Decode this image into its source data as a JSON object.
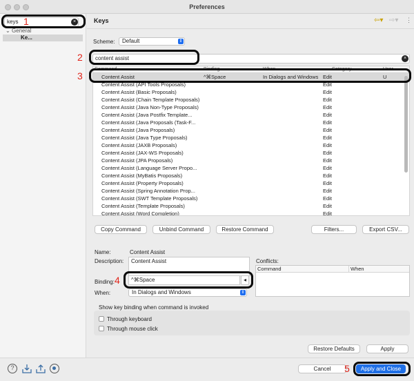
{
  "window": {
    "title": "Preferences"
  },
  "sidebar": {
    "filter_value": "keys",
    "tree": {
      "group": "General",
      "item": "Ke..."
    }
  },
  "header": {
    "title": "Keys"
  },
  "scheme": {
    "label": "Scheme:",
    "value": "Default"
  },
  "command_filter": {
    "value": "content assist"
  },
  "table": {
    "columns": [
      "Command",
      "Binding",
      "When",
      "Category",
      "User"
    ],
    "rows": [
      {
        "command": "Content Assist",
        "binding": "^⌘Space",
        "when": "In Dialogs and Windows",
        "category": "Edit",
        "user": "U"
      },
      {
        "command": "Content Assist (API Tools Proposals)",
        "binding": "",
        "when": "",
        "category": "Edit",
        "user": ""
      },
      {
        "command": "Content Assist (Basic Proposals)",
        "binding": "",
        "when": "",
        "category": "Edit",
        "user": ""
      },
      {
        "command": "Content Assist (Chain Template Proposals)",
        "binding": "",
        "when": "",
        "category": "Edit",
        "user": ""
      },
      {
        "command": "Content Assist (Java Non-Type Proposals)",
        "binding": "",
        "when": "",
        "category": "Edit",
        "user": ""
      },
      {
        "command": "Content Assist (Java Postfix Template...",
        "binding": "",
        "when": "",
        "category": "Edit",
        "user": ""
      },
      {
        "command": "Content Assist (Java Proposals (Task-F...",
        "binding": "",
        "when": "",
        "category": "Edit",
        "user": ""
      },
      {
        "command": "Content Assist (Java Proposals)",
        "binding": "",
        "when": "",
        "category": "Edit",
        "user": ""
      },
      {
        "command": "Content Assist (Java Type Proposals)",
        "binding": "",
        "when": "",
        "category": "Edit",
        "user": ""
      },
      {
        "command": "Content Assist (JAXB Proposals)",
        "binding": "",
        "when": "",
        "category": "Edit",
        "user": ""
      },
      {
        "command": "Content Assist (JAX-WS Proposals)",
        "binding": "",
        "when": "",
        "category": "Edit",
        "user": ""
      },
      {
        "command": "Content Assist (JPA Proposals)",
        "binding": "",
        "when": "",
        "category": "Edit",
        "user": ""
      },
      {
        "command": "Content Assist (Language Server Propo...",
        "binding": "",
        "when": "",
        "category": "Edit",
        "user": ""
      },
      {
        "command": "Content Assist (MyBatis Proposals)",
        "binding": "",
        "when": "",
        "category": "Edit",
        "user": ""
      },
      {
        "command": "Content Assist (Property Proposals)",
        "binding": "",
        "when": "",
        "category": "Edit",
        "user": ""
      },
      {
        "command": "Content Assist (Spring Annotation Prop...",
        "binding": "",
        "when": "",
        "category": "Edit",
        "user": ""
      },
      {
        "command": "Content Assist (SWT Template Proposals)",
        "binding": "",
        "when": "",
        "category": "Edit",
        "user": ""
      },
      {
        "command": "Content Assist (Template Proposals)",
        "binding": "",
        "when": "",
        "category": "Edit",
        "user": ""
      },
      {
        "command": "Content Assist (Word Completion)",
        "binding": "",
        "when": "",
        "category": "Edit",
        "user": ""
      }
    ]
  },
  "buttons": {
    "copy_command": "Copy Command",
    "unbind_command": "Unbind Command",
    "restore_command": "Restore Command",
    "filters": "Filters...",
    "export_csv": "Export CSV...",
    "restore_defaults": "Restore Defaults",
    "apply": "Apply",
    "cancel": "Cancel",
    "apply_and_close": "Apply and Close"
  },
  "details": {
    "name_label": "Name:",
    "name_value": "Content Assist",
    "description_label": "Description:",
    "description_value": "Content Assist",
    "binding_label": "Binding:",
    "binding_value": "^⌘Space",
    "when_label": "When:",
    "when_value": "In Dialogs and Windows",
    "conflicts_label": "Conflicts:",
    "conflicts_columns": [
      "Command",
      "When"
    ]
  },
  "show_binding": {
    "label": "Show key binding when command is invoked",
    "through_keyboard": "Through keyboard",
    "through_mouse": "Through mouse click"
  },
  "annotations": [
    "1",
    "2",
    "3",
    "4",
    "5"
  ],
  "colors": {
    "accent": "#1f6fe6",
    "annotation": "#e0251b",
    "selection": "#d9d9d9"
  },
  "icons": [
    "help-icon",
    "import-icon",
    "export-icon",
    "record-icon",
    "back-arrow-icon",
    "forward-arrow-icon",
    "menu-icon"
  ]
}
